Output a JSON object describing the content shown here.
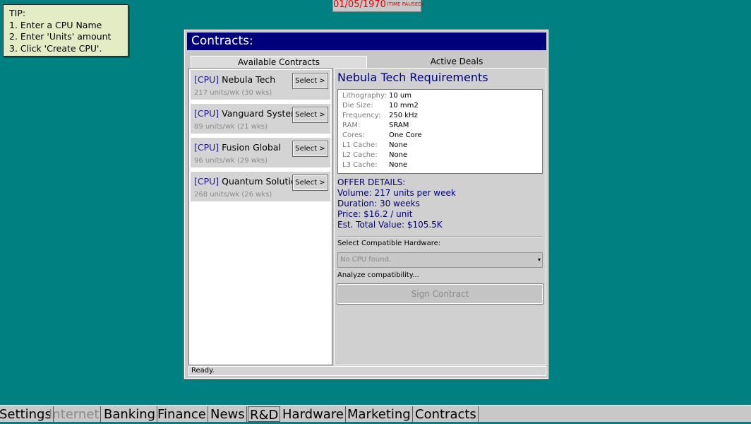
{
  "tip": {
    "title": "TIP:",
    "lines": [
      "1. Enter a CPU Name",
      "2. Enter 'Units' amount",
      "3. Click 'Create CPU'."
    ]
  },
  "clock": {
    "date": "01/05/1970",
    "status": "(TIME PAUSED)"
  },
  "window": {
    "title": "Contracts:",
    "tabs": [
      {
        "label": "Available Contracts",
        "active": true
      },
      {
        "label": "Active Deals",
        "active": false
      }
    ]
  },
  "contracts": [
    {
      "tag": "[CPU]",
      "name": "Nebula Tech",
      "detail": "217 units/wk (30 wks)",
      "select_label": "Select >"
    },
    {
      "tag": "[CPU]",
      "name": "Vanguard Systems",
      "detail": "89 units/wk (21 wks)",
      "select_label": "Select >"
    },
    {
      "tag": "[CPU]",
      "name": "Fusion Global",
      "detail": "96 units/wk (29 wks)",
      "select_label": "Select >"
    },
    {
      "tag": "[CPU]",
      "name": "Quantum Solutions",
      "detail": "268 units/wk (26 wks)",
      "select_label": "Select >"
    }
  ],
  "requirements": {
    "title": "Nebula Tech Requirements",
    "specs": [
      {
        "key": "Lithography:",
        "value": "10 um"
      },
      {
        "key": "Die Size:",
        "value": "10 mm2"
      },
      {
        "key": "Frequency:",
        "value": "250 kHz"
      },
      {
        "key": "RAM:",
        "value": "SRAM"
      },
      {
        "key": "Cores:",
        "value": "One Core"
      },
      {
        "key": "L1 Cache:",
        "value": "None"
      },
      {
        "key": "L2 Cache:",
        "value": "None"
      },
      {
        "key": "L3 Cache:",
        "value": "None"
      }
    ]
  },
  "offer": {
    "heading": "OFFER DETAILS:",
    "volume": "Volume: 217 units per week",
    "duration": "Duration: 30 weeks",
    "price": "Price: $16.2 / unit",
    "total": "Est. Total Value: $105.5K"
  },
  "hardware": {
    "label": "Select Compatible Hardware:",
    "selected": "No CPU found.",
    "analyze": "Analyze compatibility...",
    "sign_label": "Sign Contract"
  },
  "status": "Ready.",
  "taskbar": [
    {
      "label": "Settings",
      "disabled": false
    },
    {
      "label": "Internet",
      "disabled": true
    },
    {
      "label": "Banking",
      "disabled": false
    },
    {
      "label": "Finance",
      "disabled": false
    },
    {
      "label": "News",
      "disabled": false
    },
    {
      "label": "R&D",
      "disabled": false
    },
    {
      "label": "Hardware",
      "disabled": false
    },
    {
      "label": "Marketing",
      "disabled": false
    },
    {
      "label": "Contracts",
      "disabled": false
    }
  ],
  "colors": {
    "desktop": "#008080",
    "titlebar": "#00007a",
    "clock_text": "#e00000",
    "tip_bg": "#e4ecc6"
  }
}
